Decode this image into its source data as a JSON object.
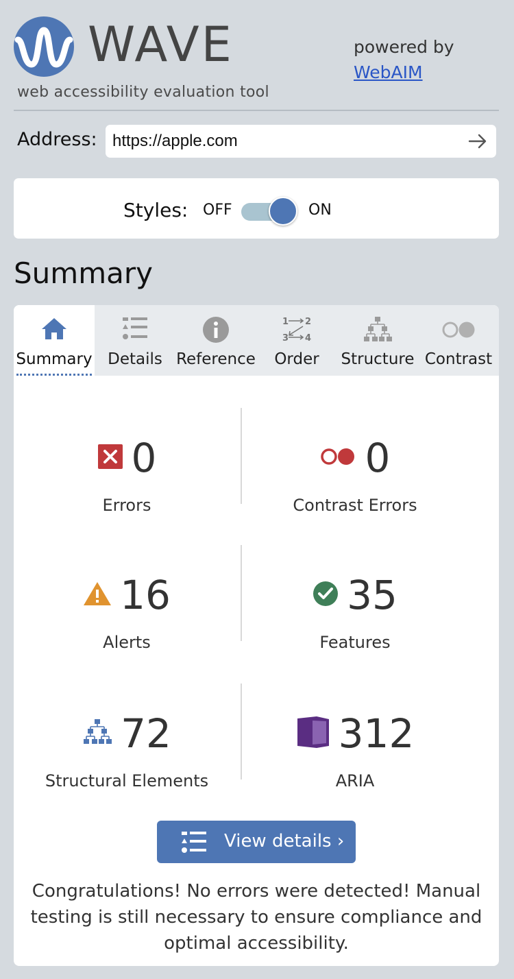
{
  "header": {
    "logo_word": "WAVE",
    "tagline": "web accessibility evaluation tool",
    "powered_by": "powered by",
    "webaim_link": "WebAIM"
  },
  "address": {
    "label": "Address:",
    "value": "https://apple.com",
    "go_icon": "arrow-right-icon"
  },
  "styles": {
    "label": "Styles:",
    "off": "OFF",
    "on": "ON",
    "state": "on"
  },
  "summary_heading": "Summary",
  "tabs": [
    {
      "label": "Summary",
      "icon": "home-icon",
      "active": true
    },
    {
      "label": "Details",
      "icon": "list-icon",
      "active": false
    },
    {
      "label": "Reference",
      "icon": "info-icon",
      "active": false
    },
    {
      "label": "Order",
      "icon": "order-icon",
      "active": false
    },
    {
      "label": "Structure",
      "icon": "structure-icon",
      "active": false
    },
    {
      "label": "Contrast",
      "icon": "contrast-icon",
      "active": false
    }
  ],
  "stats": {
    "errors": {
      "value": "0",
      "label": "Errors",
      "icon": "error-icon"
    },
    "contrast_errors": {
      "value": "0",
      "label": "Contrast Errors",
      "icon": "contrast-error-icon"
    },
    "alerts": {
      "value": "16",
      "label": "Alerts",
      "icon": "alert-icon"
    },
    "features": {
      "value": "35",
      "label": "Features",
      "icon": "feature-icon"
    },
    "structural": {
      "value": "72",
      "label": "Structural Elements",
      "icon": "structure-icon"
    },
    "aria": {
      "value": "312",
      "label": "ARIA",
      "icon": "aria-icon"
    }
  },
  "view_details_button": "View details ›",
  "congrats_message": "Congratulations! No errors were detected! Manual testing is still necessary to ensure compliance and optimal accessibility.",
  "colors": {
    "brand_blue": "#4e76b4",
    "error_red": "#c0393b",
    "alert_orange": "#e0932f",
    "feature_green": "#3f7f58",
    "aria_purple": "#5a2d82",
    "background": "#d5dadf"
  }
}
